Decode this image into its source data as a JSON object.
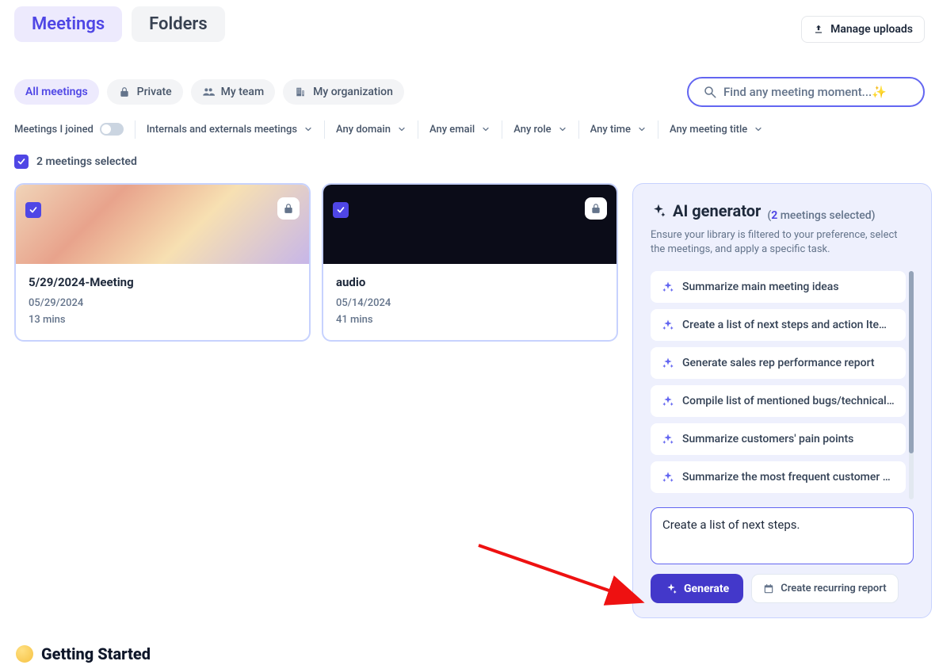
{
  "header": {
    "tabs": {
      "meetings": "Meetings",
      "folders": "Folders"
    },
    "manage_uploads": "Manage uploads"
  },
  "filters": {
    "pills": {
      "all": "All meetings",
      "private": "Private",
      "team": "My team",
      "org": "My organization"
    },
    "search_placeholder": "Find any meeting moment...✨",
    "joined_label": "Meetings I joined",
    "dropdowns": {
      "scope": "Internals and externals meetings",
      "domain": "Any domain",
      "email": "Any email",
      "role": "Any role",
      "time": "Any time",
      "title": "Any meeting title"
    }
  },
  "selection": {
    "text": "2 meetings selected",
    "count": 2
  },
  "meetings": [
    {
      "title": "5/29/2024-Meeting",
      "date": "05/29/2024",
      "duration": "13 mins"
    },
    {
      "title": "audio",
      "date": "05/14/2024",
      "duration": "41 mins"
    }
  ],
  "ai_panel": {
    "title": "AI generator",
    "count_prefix": "(",
    "count_num": "2",
    "count_suffix": " meetings selected)",
    "description": "Ensure your library is filtered to your preference, select the meetings, and apply a specific task.",
    "suggestions": [
      "Summarize main meeting ideas",
      "Create a list of next steps and action Ite…",
      "Generate sales rep performance report",
      "Compile list of mentioned bugs/technical…",
      "Summarize customers' pain points",
      "Summarize the most frequent customer …"
    ],
    "prompt_value": "Create a list of next steps.",
    "generate_label": "Generate",
    "recurring_label": "Create recurring report"
  },
  "footer": {
    "getting_started": "Getting Started"
  },
  "colors": {
    "accent": "#4f46e5"
  }
}
